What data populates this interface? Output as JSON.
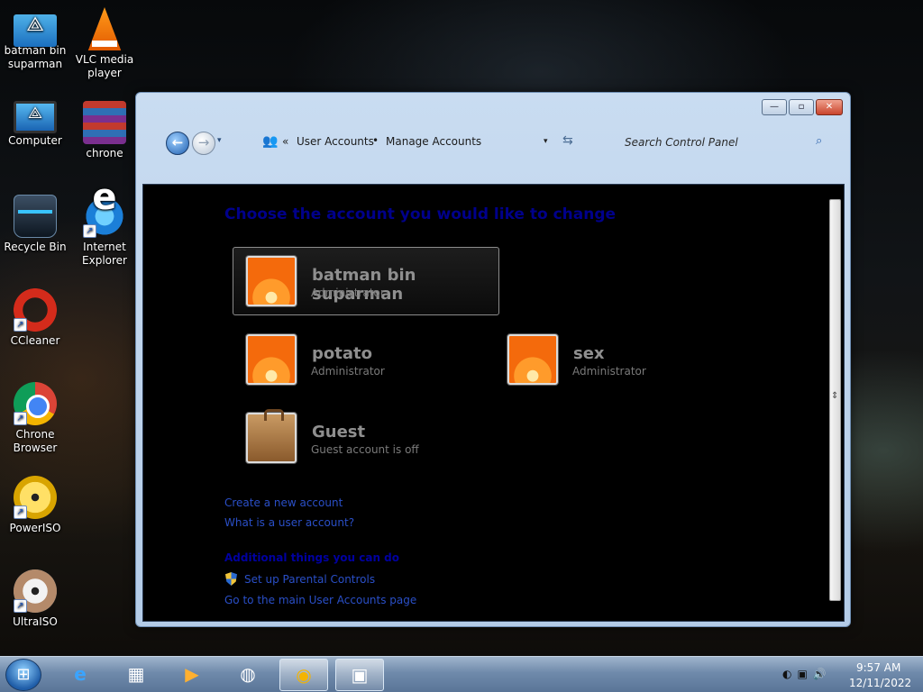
{
  "desktop": {
    "icons": [
      {
        "label": "batman bin suparman"
      },
      {
        "label": "VLC media player"
      },
      {
        "label": "Computer"
      },
      {
        "label": "chrone"
      },
      {
        "label": "Recycle Bin"
      },
      {
        "label": "Internet Explorer"
      },
      {
        "label": "CCleaner"
      },
      {
        "label": "Chrone Browser"
      },
      {
        "label": "PowerISO"
      },
      {
        "label": "UltraISO"
      }
    ]
  },
  "window": {
    "controls": {
      "minimize": "—",
      "maximize": "▫",
      "close": "✕"
    },
    "nav": {
      "back": "←",
      "forward": "→",
      "recent": "▾"
    },
    "address": {
      "chevron": "«",
      "crumbs": [
        "User Accounts",
        "Manage Accounts"
      ],
      "separator": "•",
      "dropdown": "▾",
      "refresh": "⇆"
    },
    "search": {
      "placeholder": "Search Control Panel",
      "icon": "⌕"
    },
    "content": {
      "title": "Choose the account you would like to change",
      "accounts": [
        {
          "name": "batman bin suparman",
          "role": "Administrator",
          "selected": true
        },
        {
          "name": "potato",
          "role": "Administrator"
        },
        {
          "name": "sex",
          "role": "Administrator"
        },
        {
          "name": "Guest",
          "role": "Guest account is off"
        }
      ],
      "links": [
        "Create a new account",
        "What is a user account?"
      ],
      "additional_heading": "Additional things you can do",
      "additional_links": [
        "Set up Parental Controls",
        "Go to the main User Accounts page"
      ]
    }
  },
  "taskbar": {
    "clock_time": "9:57 AM",
    "clock_date": "12/11/2022",
    "start_glyph": "⊞",
    "tray_icons": "◐▣🔊"
  }
}
